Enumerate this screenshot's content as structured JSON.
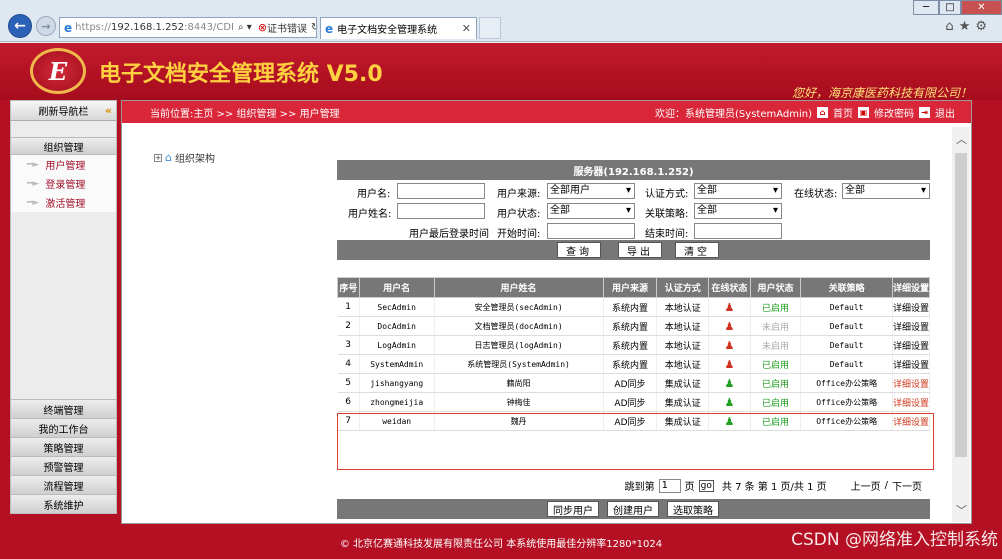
{
  "browser": {
    "url_prefix": "https://",
    "url_host": "192.168.1.252",
    "url_rest": ":8443/CDI",
    "cert_error": "证书错误",
    "tab_title": "电子文档安全管理系统"
  },
  "header": {
    "logo_letter": "E",
    "title": "电子文档安全管理系统 V5.0",
    "slogan": "您好，海京康医药科技有限公司！"
  },
  "sidebar": {
    "header": "刷新导航栏",
    "section": "组织管理",
    "items": [
      "用户管理",
      "登录管理",
      "激活管理"
    ],
    "bottom": [
      "终端管理",
      "我的工作台",
      "策略管理",
      "预警管理",
      "流程管理",
      "系统维护"
    ]
  },
  "topbar": {
    "breadcrumb": "当前位置:主页 >> 组织管理 >> 用户管理",
    "welcome": "欢迎：系统管理员(SystemAdmin)",
    "home": "首页",
    "change_pwd": "修改密码",
    "logout": "退出"
  },
  "tree": {
    "root": "组织架构"
  },
  "search": {
    "server": "服务器(192.168.1.252)",
    "labels": {
      "username": "用户名:",
      "source": "用户来源:",
      "auth": "认证方式:",
      "online": "在线状态:",
      "fullname": "用户姓名:",
      "status": "用户状态:",
      "policy": "关联策略:",
      "last_login": "用户最后登录时间",
      "start": "开始时间:",
      "end": "结束时间:"
    },
    "values": {
      "source": "全部用户",
      "auth": "全部",
      "online": "全部",
      "status": "全部",
      "policy": "全部"
    },
    "buttons": {
      "query": "查询",
      "export": "导出",
      "clear": "清空"
    }
  },
  "table": {
    "headers": [
      "序号",
      "用户名",
      "用户姓名",
      "用户来源",
      "认证方式",
      "在线状态",
      "用户状态",
      "关联策略",
      "详细设置"
    ],
    "rows": [
      {
        "no": "1",
        "user": "SecAdmin",
        "name": "安全管理员(secAdmin)",
        "source": "系统内置",
        "auth": "本地认证",
        "online": "offline",
        "status": "已启用",
        "status_kind": "green",
        "policy": "Default",
        "detail": "详细设置",
        "detail_kind": "plain"
      },
      {
        "no": "2",
        "user": "DocAdmin",
        "name": "文档管理员(docAdmin)",
        "source": "系统内置",
        "auth": "本地认证",
        "online": "offline",
        "status": "未启用",
        "status_kind": "gray",
        "policy": "Default",
        "detail": "详细设置",
        "detail_kind": "plain"
      },
      {
        "no": "3",
        "user": "LogAdmin",
        "name": "日志管理员(logAdmin)",
        "source": "系统内置",
        "auth": "本地认证",
        "online": "offline",
        "status": "未启用",
        "status_kind": "gray",
        "policy": "Default",
        "detail": "详细设置",
        "detail_kind": "plain"
      },
      {
        "no": "4",
        "user": "SystemAdmin",
        "name": "系统管理员(SystemAdmin)",
        "source": "系统内置",
        "auth": "本地认证",
        "online": "offline",
        "status": "已启用",
        "status_kind": "green",
        "policy": "Default",
        "detail": "详细设置",
        "detail_kind": "plain"
      },
      {
        "no": "5",
        "user": "jishangyang",
        "name": "籍尚阳",
        "source": "AD同步",
        "auth": "集成认证",
        "online": "online",
        "status": "已启用",
        "status_kind": "green",
        "policy": "Office办公策略",
        "detail": "详细设置",
        "detail_kind": "red"
      },
      {
        "no": "6",
        "user": "zhongmeijia",
        "name": "钟梅佳",
        "source": "AD同步",
        "auth": "集成认证",
        "online": "online",
        "status": "已启用",
        "status_kind": "green",
        "policy": "Office办公策略",
        "detail": "详细设置",
        "detail_kind": "red"
      },
      {
        "no": "7",
        "user": "weidan",
        "name": "魏丹",
        "source": "AD同步",
        "auth": "集成认证",
        "online": "online",
        "status": "已启用",
        "status_kind": "green",
        "policy": "Office办公策略",
        "detail": "详细设置",
        "detail_kind": "red"
      }
    ]
  },
  "pager": {
    "goto_label": "跳到第",
    "page_input": "1",
    "page_unit": "页",
    "go": "go",
    "summary": "共 7 条  第 1 页/共 1 页",
    "prev": "上一页",
    "sep": "/",
    "next": "下一页"
  },
  "bottom_buttons": {
    "sync": "同步用户",
    "create": "创建用户",
    "policy": "选取策略"
  },
  "footer": {
    "text": "© 北京亿赛通科技发展有限责任公司  本系统使用最佳分辨率1280*1024"
  },
  "watermark": "CSDN @网络准入控制系统",
  "colors": {
    "brand_red": "#b40f22",
    "title_gold": "#ffd040",
    "panel_gray": "#777777",
    "ok_green": "#1a9a1a"
  }
}
